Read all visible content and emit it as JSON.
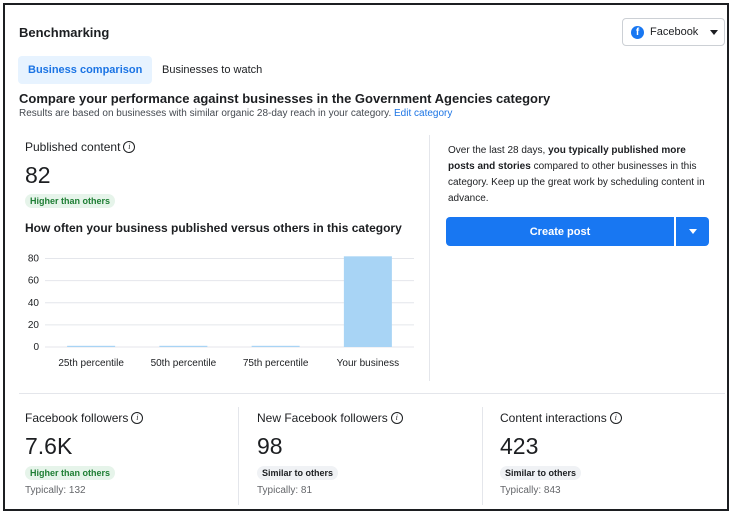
{
  "header": {
    "title": "Benchmarking"
  },
  "platform_selector": {
    "label": "Facebook",
    "icon": "facebook-icon"
  },
  "tabs": [
    {
      "label": "Business comparison",
      "active": true
    },
    {
      "label": "Businesses to watch",
      "active": false
    }
  ],
  "section": {
    "title": "Compare your performance against businesses in the Government Agencies category",
    "subtitle": "Results are based on businesses with similar organic 28-day reach in your category.",
    "edit_link": "Edit category"
  },
  "published": {
    "label": "Published content",
    "value": "82",
    "badge": "Higher than others",
    "chart_title": "How often your business published versus others in this category"
  },
  "chart_data": {
    "type": "bar",
    "categories": [
      "25th percentile",
      "50th percentile",
      "75th percentile",
      "Your business"
    ],
    "values": [
      0.3,
      0.3,
      0.3,
      82
    ],
    "ylim": [
      0,
      85
    ],
    "yticks": [
      0,
      20,
      40,
      60,
      80
    ],
    "grid": true,
    "colors": {
      "percentile": "#a8d4f5",
      "business": "#a8d4f5",
      "grid": "#e4e6eb"
    }
  },
  "insight": {
    "prefix": "Over the last 28 days, ",
    "bold": "you typically published more posts and stories",
    "suffix": " compared to other businesses in this category. Keep up the great work by scheduling content in advance."
  },
  "create_post": {
    "label": "Create post"
  },
  "metrics": [
    {
      "label": "Facebook followers",
      "value": "7.6K",
      "badge": "Higher than others",
      "badge_type": "green",
      "typical": "Typically: 132"
    },
    {
      "label": "New Facebook followers",
      "value": "98",
      "badge": "Similar to others",
      "badge_type": "gray",
      "typical": "Typically: 81"
    },
    {
      "label": "Content interactions",
      "value": "423",
      "badge": "Similar to others",
      "badge_type": "gray",
      "typical": "Typically: 843"
    }
  ],
  "colors": {
    "accent": "#1877f2",
    "link": "#1b74e4",
    "tab_bg": "#e7f3ff"
  }
}
